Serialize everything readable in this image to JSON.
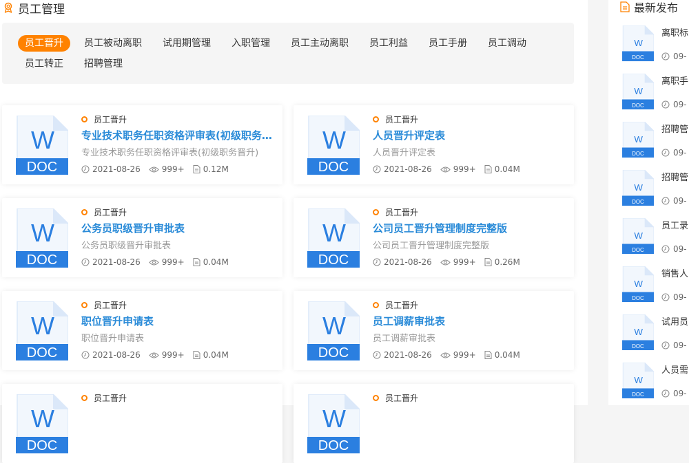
{
  "page": {
    "title": "员工管理"
  },
  "tabs": [
    {
      "label": "员工晋升",
      "active": true
    },
    {
      "label": "员工被动离职"
    },
    {
      "label": "试用期管理"
    },
    {
      "label": "入职管理"
    },
    {
      "label": "员工主动离职"
    },
    {
      "label": "员工利益"
    },
    {
      "label": "员工手册"
    },
    {
      "label": "员工调动"
    },
    {
      "label": "员工转正"
    },
    {
      "label": "招聘管理"
    }
  ],
  "doc_icon": {
    "letter": "W",
    "type": "DOC"
  },
  "cards": [
    {
      "category": "员工晋升",
      "title": "专业技术职务任职资格评审表(初级职务晋升)",
      "desc": "专业技术职务任职资格评审表(初级职务晋升)",
      "date": "2021-08-26",
      "views": "999+",
      "size": "0.12M"
    },
    {
      "category": "员工晋升",
      "title": "人员晋升评定表",
      "desc": "人员晋升评定表",
      "date": "2021-08-26",
      "views": "999+",
      "size": "0.04M"
    },
    {
      "category": "员工晋升",
      "title": "公务员职级晋升审批表",
      "desc": "公务员职级晋升审批表",
      "date": "2021-08-26",
      "views": "999+",
      "size": "0.04M"
    },
    {
      "category": "员工晋升",
      "title": "公司员工晋升管理制度完整版",
      "desc": "公司员工晋升管理制度完整版",
      "date": "2021-08-26",
      "views": "999+",
      "size": "0.26M"
    },
    {
      "category": "员工晋升",
      "title": "职位晋升申请表",
      "desc": "职位晋升申请表",
      "date": "2021-08-26",
      "views": "999+",
      "size": "0.04M"
    },
    {
      "category": "员工晋升",
      "title": "员工调薪审批表",
      "desc": "员工调薪审批表",
      "date": "2021-08-26",
      "views": "999+",
      "size": "0.04M"
    },
    {
      "category": "员工晋升"
    },
    {
      "category": "员工晋升"
    }
  ],
  "sidebar": {
    "title": "最新发布",
    "items": [
      {
        "title": "离职标",
        "date": "09-"
      },
      {
        "title": "离职手",
        "date": "09-"
      },
      {
        "title": "招聘管",
        "date": "09-"
      },
      {
        "title": "招聘管",
        "date": "09-"
      },
      {
        "title": "员工录",
        "date": "09-"
      },
      {
        "title": "销售人",
        "date": "09-"
      },
      {
        "title": "试用员",
        "date": "09-"
      },
      {
        "title": "人员需",
        "date": "09-"
      }
    ]
  },
  "colors": {
    "accent": "#ff8200",
    "link": "#2a8bd8",
    "doc_blue": "#2b7fe0",
    "doc_light": "#dbe8f9"
  }
}
